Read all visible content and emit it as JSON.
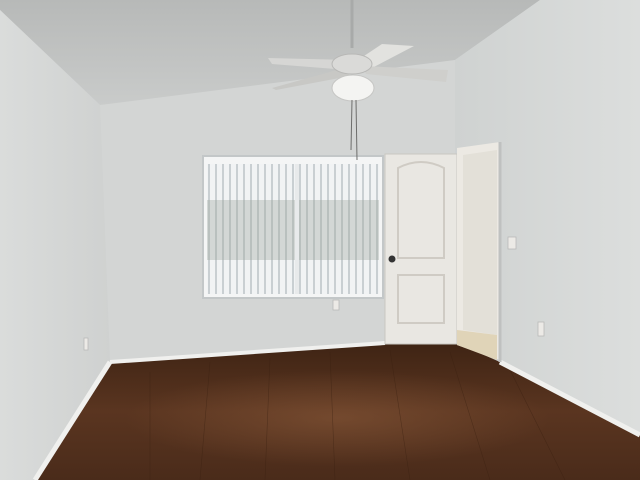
{
  "scene": {
    "kind": "photo-interior-empty-room",
    "colors": {
      "ceiling": "#c4c6c5",
      "back_wall": "#d2d4d3",
      "left_wall": "#d8dad9",
      "right_wall": "#d5d7d6",
      "floor": "#4a2b1a",
      "baseboard": "#eeeeec",
      "door": "#e9e7e2",
      "window_blinds": "#e8ecee",
      "fan_body": "#d8d8d6"
    }
  }
}
